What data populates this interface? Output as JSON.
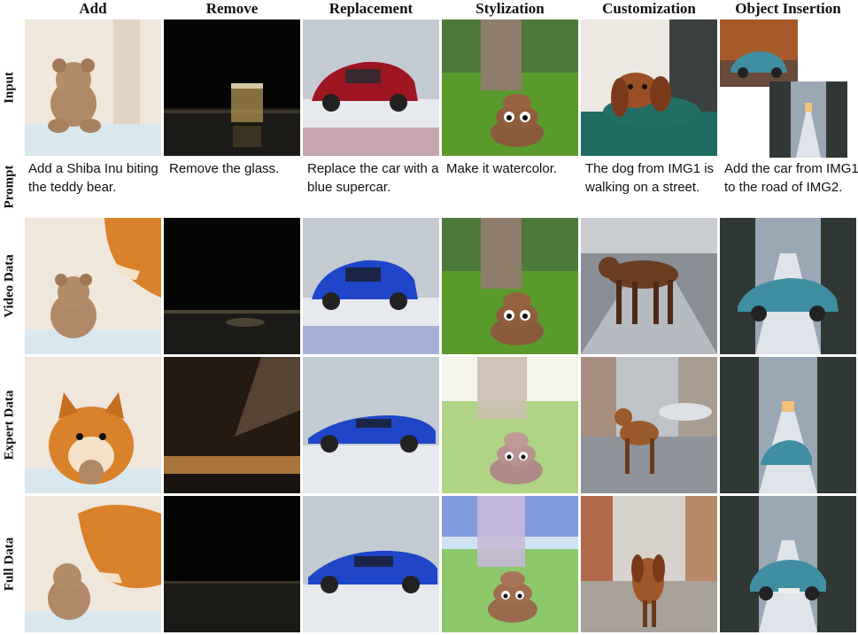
{
  "columns": [
    "Add",
    "Remove",
    "Replacement",
    "Stylization",
    "Customization",
    "Object Insertion"
  ],
  "row_labels": {
    "input": "Input",
    "prompt": "Prompt",
    "video": "Video Data",
    "expert": "Expert Data",
    "full": "Full Data"
  },
  "prompts": [
    "Add a Shiba Inu biting the teddy bear.",
    "Remove the glass.",
    "Replace the car with a blue supercar.",
    "Make it watercolor.",
    "The dog from IMG1 is walking on a street.",
    "Add the car from IMG1 to the road of IMG2."
  ],
  "colors": {
    "bear": "#b08a68",
    "shiba": "#d9822b",
    "red_car": "#9e1622",
    "blue_car": "#1f46c8",
    "teal_car": "#3f8ea1",
    "grass": "#5a9a2c",
    "poop": "#8a5a3c",
    "dog": "#6b3d22"
  }
}
